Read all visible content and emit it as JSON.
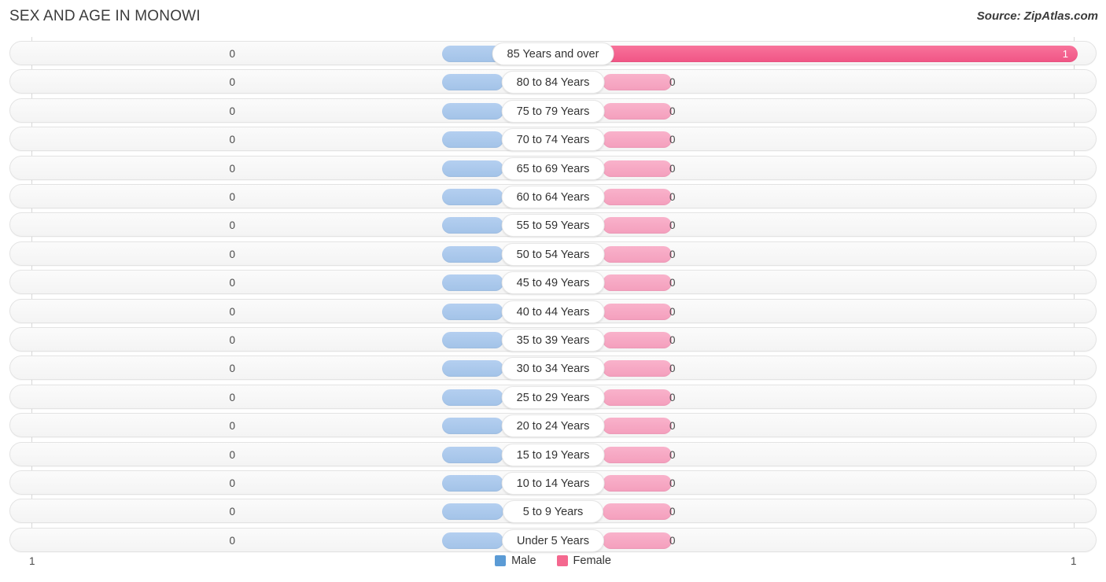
{
  "header": {
    "title": "SEX AND AGE IN MONOWI",
    "source": "Source: ZipAtlas.com"
  },
  "legend": {
    "male": {
      "label": "Male",
      "color": "#5B9BD5"
    },
    "female": {
      "label": "Female",
      "color": "#F4688F"
    }
  },
  "axis": {
    "left_tick": "1",
    "right_tick": "1"
  },
  "colors": {
    "male_bar": "#A8C8EC",
    "female_bar": "#F7A8C4",
    "female_bar_highlight": "#F4688F",
    "row_background": "#F6F6F6",
    "row_border": "#E3E3E3"
  },
  "chart_data": {
    "type": "bar",
    "title": "SEX AND AGE IN MONOWI",
    "subtitle": "Source: ZipAtlas.com",
    "orientation": "horizontal-diverging",
    "xlabel": "",
    "ylabel": "",
    "xlim": [
      1,
      1
    ],
    "grid": false,
    "legend_position": "bottom-center",
    "categories": [
      "85 Years and over",
      "80 to 84 Years",
      "75 to 79 Years",
      "70 to 74 Years",
      "65 to 69 Years",
      "60 to 64 Years",
      "55 to 59 Years",
      "50 to 54 Years",
      "45 to 49 Years",
      "40 to 44 Years",
      "35 to 39 Years",
      "30 to 34 Years",
      "25 to 29 Years",
      "20 to 24 Years",
      "15 to 19 Years",
      "10 to 14 Years",
      "5 to 9 Years",
      "Under 5 Years"
    ],
    "series": [
      {
        "name": "Male",
        "values": [
          0,
          0,
          0,
          0,
          0,
          0,
          0,
          0,
          0,
          0,
          0,
          0,
          0,
          0,
          0,
          0,
          0,
          0
        ]
      },
      {
        "name": "Female",
        "values": [
          1,
          0,
          0,
          0,
          0,
          0,
          0,
          0,
          0,
          0,
          0,
          0,
          0,
          0,
          0,
          0,
          0,
          0
        ]
      }
    ]
  },
  "rows": [
    {
      "label": "85 Years and over",
      "male": "0",
      "female": "1",
      "female_highlight": true,
      "female_width": 604,
      "male_width": 78,
      "female_value_inside": true
    },
    {
      "label": "80 to 84 Years",
      "male": "0",
      "female": "0",
      "female_highlight": false,
      "female_width": 88,
      "male_width": 78,
      "female_value_inside": false
    },
    {
      "label": "75 to 79 Years",
      "male": "0",
      "female": "0",
      "female_highlight": false,
      "female_width": 88,
      "male_width": 78,
      "female_value_inside": false
    },
    {
      "label": "70 to 74 Years",
      "male": "0",
      "female": "0",
      "female_highlight": false,
      "female_width": 88,
      "male_width": 78,
      "female_value_inside": false
    },
    {
      "label": "65 to 69 Years",
      "male": "0",
      "female": "0",
      "female_highlight": false,
      "female_width": 88,
      "male_width": 78,
      "female_value_inside": false
    },
    {
      "label": "60 to 64 Years",
      "male": "0",
      "female": "0",
      "female_highlight": false,
      "female_width": 88,
      "male_width": 78,
      "female_value_inside": false
    },
    {
      "label": "55 to 59 Years",
      "male": "0",
      "female": "0",
      "female_highlight": false,
      "female_width": 88,
      "male_width": 78,
      "female_value_inside": false
    },
    {
      "label": "50 to 54 Years",
      "male": "0",
      "female": "0",
      "female_highlight": false,
      "female_width": 88,
      "male_width": 78,
      "female_value_inside": false
    },
    {
      "label": "45 to 49 Years",
      "male": "0",
      "female": "0",
      "female_highlight": false,
      "female_width": 88,
      "male_width": 78,
      "female_value_inside": false
    },
    {
      "label": "40 to 44 Years",
      "male": "0",
      "female": "0",
      "female_highlight": false,
      "female_width": 88,
      "male_width": 78,
      "female_value_inside": false
    },
    {
      "label": "35 to 39 Years",
      "male": "0",
      "female": "0",
      "female_highlight": false,
      "female_width": 88,
      "male_width": 78,
      "female_value_inside": false
    },
    {
      "label": "30 to 34 Years",
      "male": "0",
      "female": "0",
      "female_highlight": false,
      "female_width": 88,
      "male_width": 78,
      "female_value_inside": false
    },
    {
      "label": "25 to 29 Years",
      "male": "0",
      "female": "0",
      "female_highlight": false,
      "female_width": 88,
      "male_width": 78,
      "female_value_inside": false
    },
    {
      "label": "20 to 24 Years",
      "male": "0",
      "female": "0",
      "female_highlight": false,
      "female_width": 88,
      "male_width": 78,
      "female_value_inside": false
    },
    {
      "label": "15 to 19 Years",
      "male": "0",
      "female": "0",
      "female_highlight": false,
      "female_width": 88,
      "male_width": 78,
      "female_value_inside": false
    },
    {
      "label": "10 to 14 Years",
      "male": "0",
      "female": "0",
      "female_highlight": false,
      "female_width": 88,
      "male_width": 78,
      "female_value_inside": false
    },
    {
      "label": "5 to 9 Years",
      "male": "0",
      "female": "0",
      "female_highlight": false,
      "female_width": 88,
      "male_width": 78,
      "female_value_inside": false
    },
    {
      "label": "Under 5 Years",
      "male": "0",
      "female": "0",
      "female_highlight": false,
      "female_width": 88,
      "male_width": 78,
      "female_value_inside": false
    }
  ]
}
